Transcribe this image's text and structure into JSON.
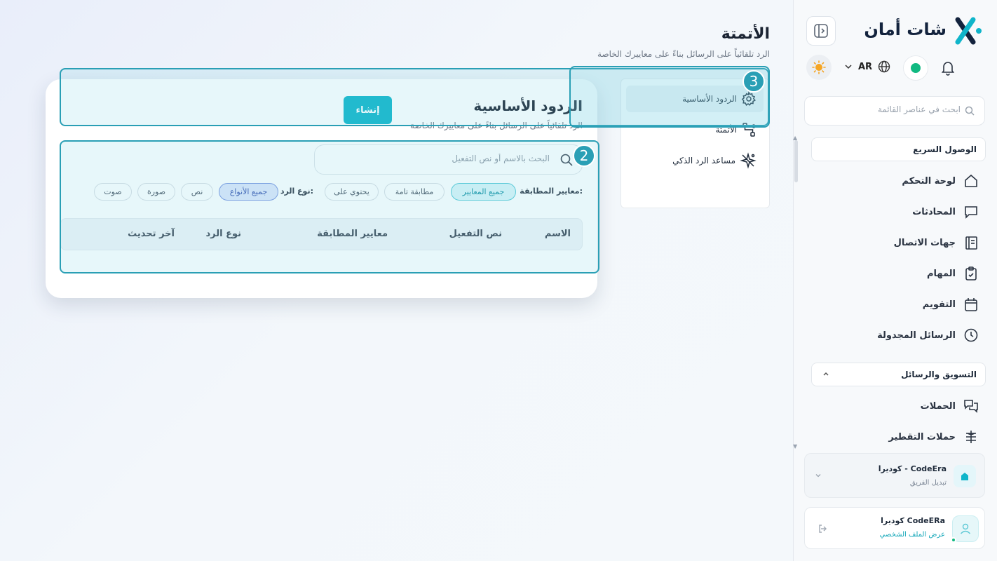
{
  "sidebar": {
    "brand": "شات أمان",
    "language": "AR",
    "search_placeholder": "ابحث في عناصر القائمة",
    "quick_access_label": "الوصول السريع",
    "quick_items": [
      {
        "label": "لوحة التحكم",
        "icon": "home-icon"
      },
      {
        "label": "المحادثات",
        "icon": "chat-icon"
      },
      {
        "label": "جهات الاتصال",
        "icon": "contacts-icon"
      },
      {
        "label": "المهام",
        "icon": "clipboard-check-icon"
      },
      {
        "label": "التقويم",
        "icon": "calendar-icon"
      },
      {
        "label": "الرسائل المجدولة",
        "icon": "clock-icon"
      }
    ],
    "marketing_label": "التسويق والرسائل",
    "marketing_items": [
      {
        "label": "الحملات",
        "icon": "chats-icon"
      },
      {
        "label": "حملات التقطير",
        "icon": "drip-icon"
      }
    ],
    "team": {
      "name": "كوديرا - CodeEra",
      "switch_label": "تبديل الفريق"
    },
    "profile": {
      "name": "كوديرا CodeERa",
      "view_profile": "عرض الملف الشخصي"
    }
  },
  "header": {
    "title": "الأتمتة",
    "subtitle": "الرد تلقائياً على الرسائل بناءً على معاييرك الخاصة"
  },
  "subnav": {
    "items": [
      {
        "label": "الردود الأساسية",
        "icon": "gear-icon",
        "active": true
      },
      {
        "label": "الأتمتة",
        "icon": "flow-icon",
        "active": false
      },
      {
        "label": "مساعد الرد الذكي",
        "icon": "sparkle-icon",
        "active": false
      }
    ]
  },
  "main": {
    "title": "الردود الأساسية",
    "subtitle": "الرد تلقائياً على الرسائل بناءً على معاييرك الخاصة",
    "create_label": "إنشاء",
    "search_placeholder": "البحث بالاسم أو نص التفعيل",
    "match_filter_label": "معايير المطابقة:",
    "match_chips": [
      "جميع المعايير",
      "مطابقة تامة",
      "يحتوي على"
    ],
    "type_filter_label": "نوع الرد:",
    "type_chips": [
      "جميع الأنواع",
      "نص",
      "صورة",
      "صوت"
    ],
    "columns": [
      "الاسم",
      "نص التفعيل",
      "معايير المطابقة",
      "نوع الرد",
      "آخر تحديث"
    ]
  },
  "annotations": [
    "2",
    "3"
  ],
  "colors": {
    "accent": "#0fb5ca",
    "highlight": "#2a9fb5",
    "online": "#11b981"
  }
}
